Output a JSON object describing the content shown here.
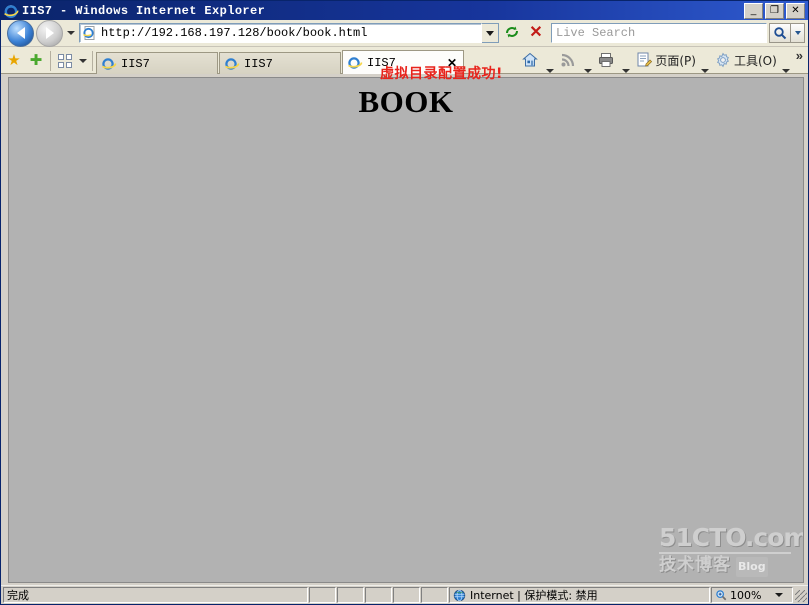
{
  "window": {
    "title": "IIS7 - Windows Internet Explorer",
    "minimize_label": "_",
    "restore_label": "❐",
    "close_label": "✕"
  },
  "navigation": {
    "back_name": "back-button",
    "forward_name": "forward-button",
    "history_dropdown": "▾",
    "address_url": "http://192.168.197.128/book/book.html",
    "address_dropdown": "▾",
    "refresh_label": "↻",
    "stop_label": "✕"
  },
  "search": {
    "placeholder": "Live Search",
    "go_label": "🔍",
    "provider_dropdown": "▾"
  },
  "annotation": {
    "text": "虚拟目录配置成功!"
  },
  "favorites": {
    "favorites_center": "★",
    "add_to_favorites": "✚"
  },
  "tabs": {
    "quick_tabs_label": "Quick Tabs",
    "quick_tabs_dropdown": "▾",
    "items": [
      {
        "label": "IIS7",
        "active": false,
        "close": ""
      },
      {
        "label": "IIS7",
        "active": false,
        "close": ""
      },
      {
        "label": "IIS7",
        "active": true,
        "close": "✕"
      }
    ]
  },
  "command_bar": {
    "home_label": "",
    "feeds_label": "",
    "print_label": "",
    "page_label": "页面(P)",
    "tools_label": "工具(O)",
    "overflow_label": "»"
  },
  "page": {
    "heading": "BOOK",
    "background_color": "#b2b2b2"
  },
  "watermark": {
    "line1": "51CTO.com",
    "line2": "技术博客",
    "badge": "Blog"
  },
  "status_bar": {
    "status_text": "完成",
    "zone_text": "Internet  |  保护模式: 禁用",
    "zoom_level": "100%",
    "zoom_dropdown": "▾"
  }
}
